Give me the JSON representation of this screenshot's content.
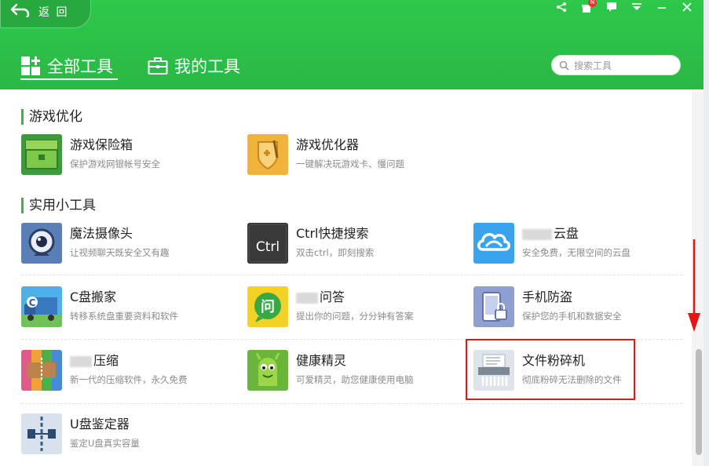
{
  "header": {
    "back_label": "返 回",
    "badge": "N",
    "tabs": [
      {
        "label": "全部工具",
        "active": true
      },
      {
        "label": "我的工具",
        "active": false
      }
    ],
    "search": {
      "placeholder": "搜索工具",
      "value": ""
    }
  },
  "sections": [
    {
      "title": "游戏优化",
      "tools": [
        {
          "name": "游戏保险箱",
          "desc": "保护游戏网银帐号安全",
          "icon": "game-safe-icon"
        },
        {
          "name": "游戏优化器",
          "desc": "一键解决玩游戏卡、慢问题",
          "icon": "game-optimizer-icon"
        }
      ]
    },
    {
      "title": "实用小工具",
      "tools": [
        {
          "name": "魔法摄像头",
          "desc": "让视频聊天既安全又有趣",
          "icon": "webcam-icon"
        },
        {
          "name": "Ctrl快捷搜索",
          "desc": "双击ctrl，即刻搜索",
          "icon": "ctrl-key-icon",
          "icon_text": "Ctrl"
        },
        {
          "name": "云盘",
          "desc": "安全免费，无限空间的云盘",
          "icon": "cloud-icon"
        },
        {
          "name": "C盘搬家",
          "desc": "转移系统盘重要资料和软件",
          "icon": "truck-icon",
          "icon_text": "C"
        },
        {
          "name": "问答",
          "desc": "提出你的问题，分分钟有答案",
          "icon": "question-bubble-icon",
          "icon_text": "问"
        },
        {
          "name": "手机防盗",
          "desc": "保护您的手机和数据安全",
          "icon": "phone-lock-icon"
        },
        {
          "name": "压缩",
          "desc": "新一代的压缩软件，永久免费",
          "icon": "archive-icon"
        },
        {
          "name": "健康精灵",
          "desc": "可爱精灵，助您健康使用电脑",
          "icon": "green-sprite-icon"
        },
        {
          "name": "文件粉碎机",
          "desc": "彻底粉碎无法删除的文件",
          "icon": "file-shredder-icon"
        },
        {
          "name": "U盘鉴定器",
          "desc": "鉴定U盘真实容量",
          "icon": "usb-check-icon"
        }
      ]
    }
  ],
  "colors": {
    "header_green": "#2fc84a",
    "section_accent": "#3bb54a",
    "highlight_red": "#e21818"
  }
}
